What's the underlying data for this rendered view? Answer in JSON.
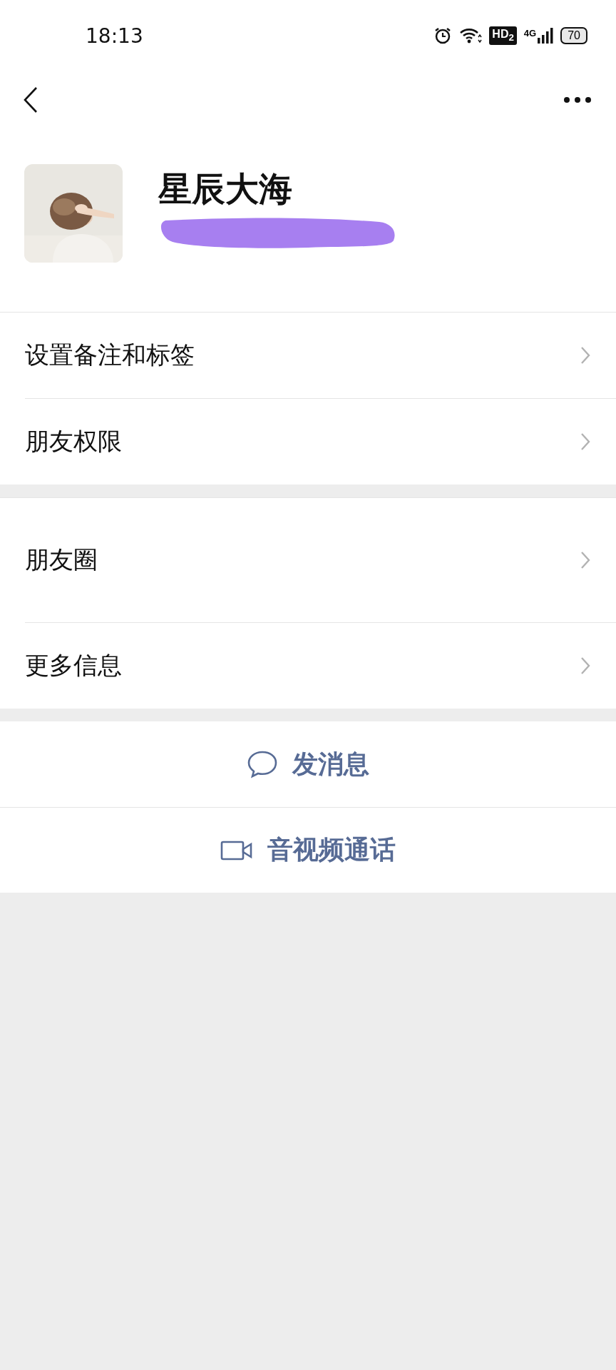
{
  "status_bar": {
    "time": "18:13",
    "hd_badge": "HD$_{2}$",
    "network": "4G",
    "battery": "70"
  },
  "profile": {
    "name": "星辰大海"
  },
  "menu_groups": [
    [
      {
        "label": "设置备注和标签",
        "tall": false
      },
      {
        "label": "朋友权限",
        "tall": false
      }
    ],
    [
      {
        "label": "朋友圈",
        "tall": true
      },
      {
        "label": "更多信息",
        "tall": false
      }
    ]
  ],
  "actions": [
    {
      "label": "发消息",
      "kind": "message"
    },
    {
      "label": "音视频通话",
      "kind": "video"
    }
  ]
}
